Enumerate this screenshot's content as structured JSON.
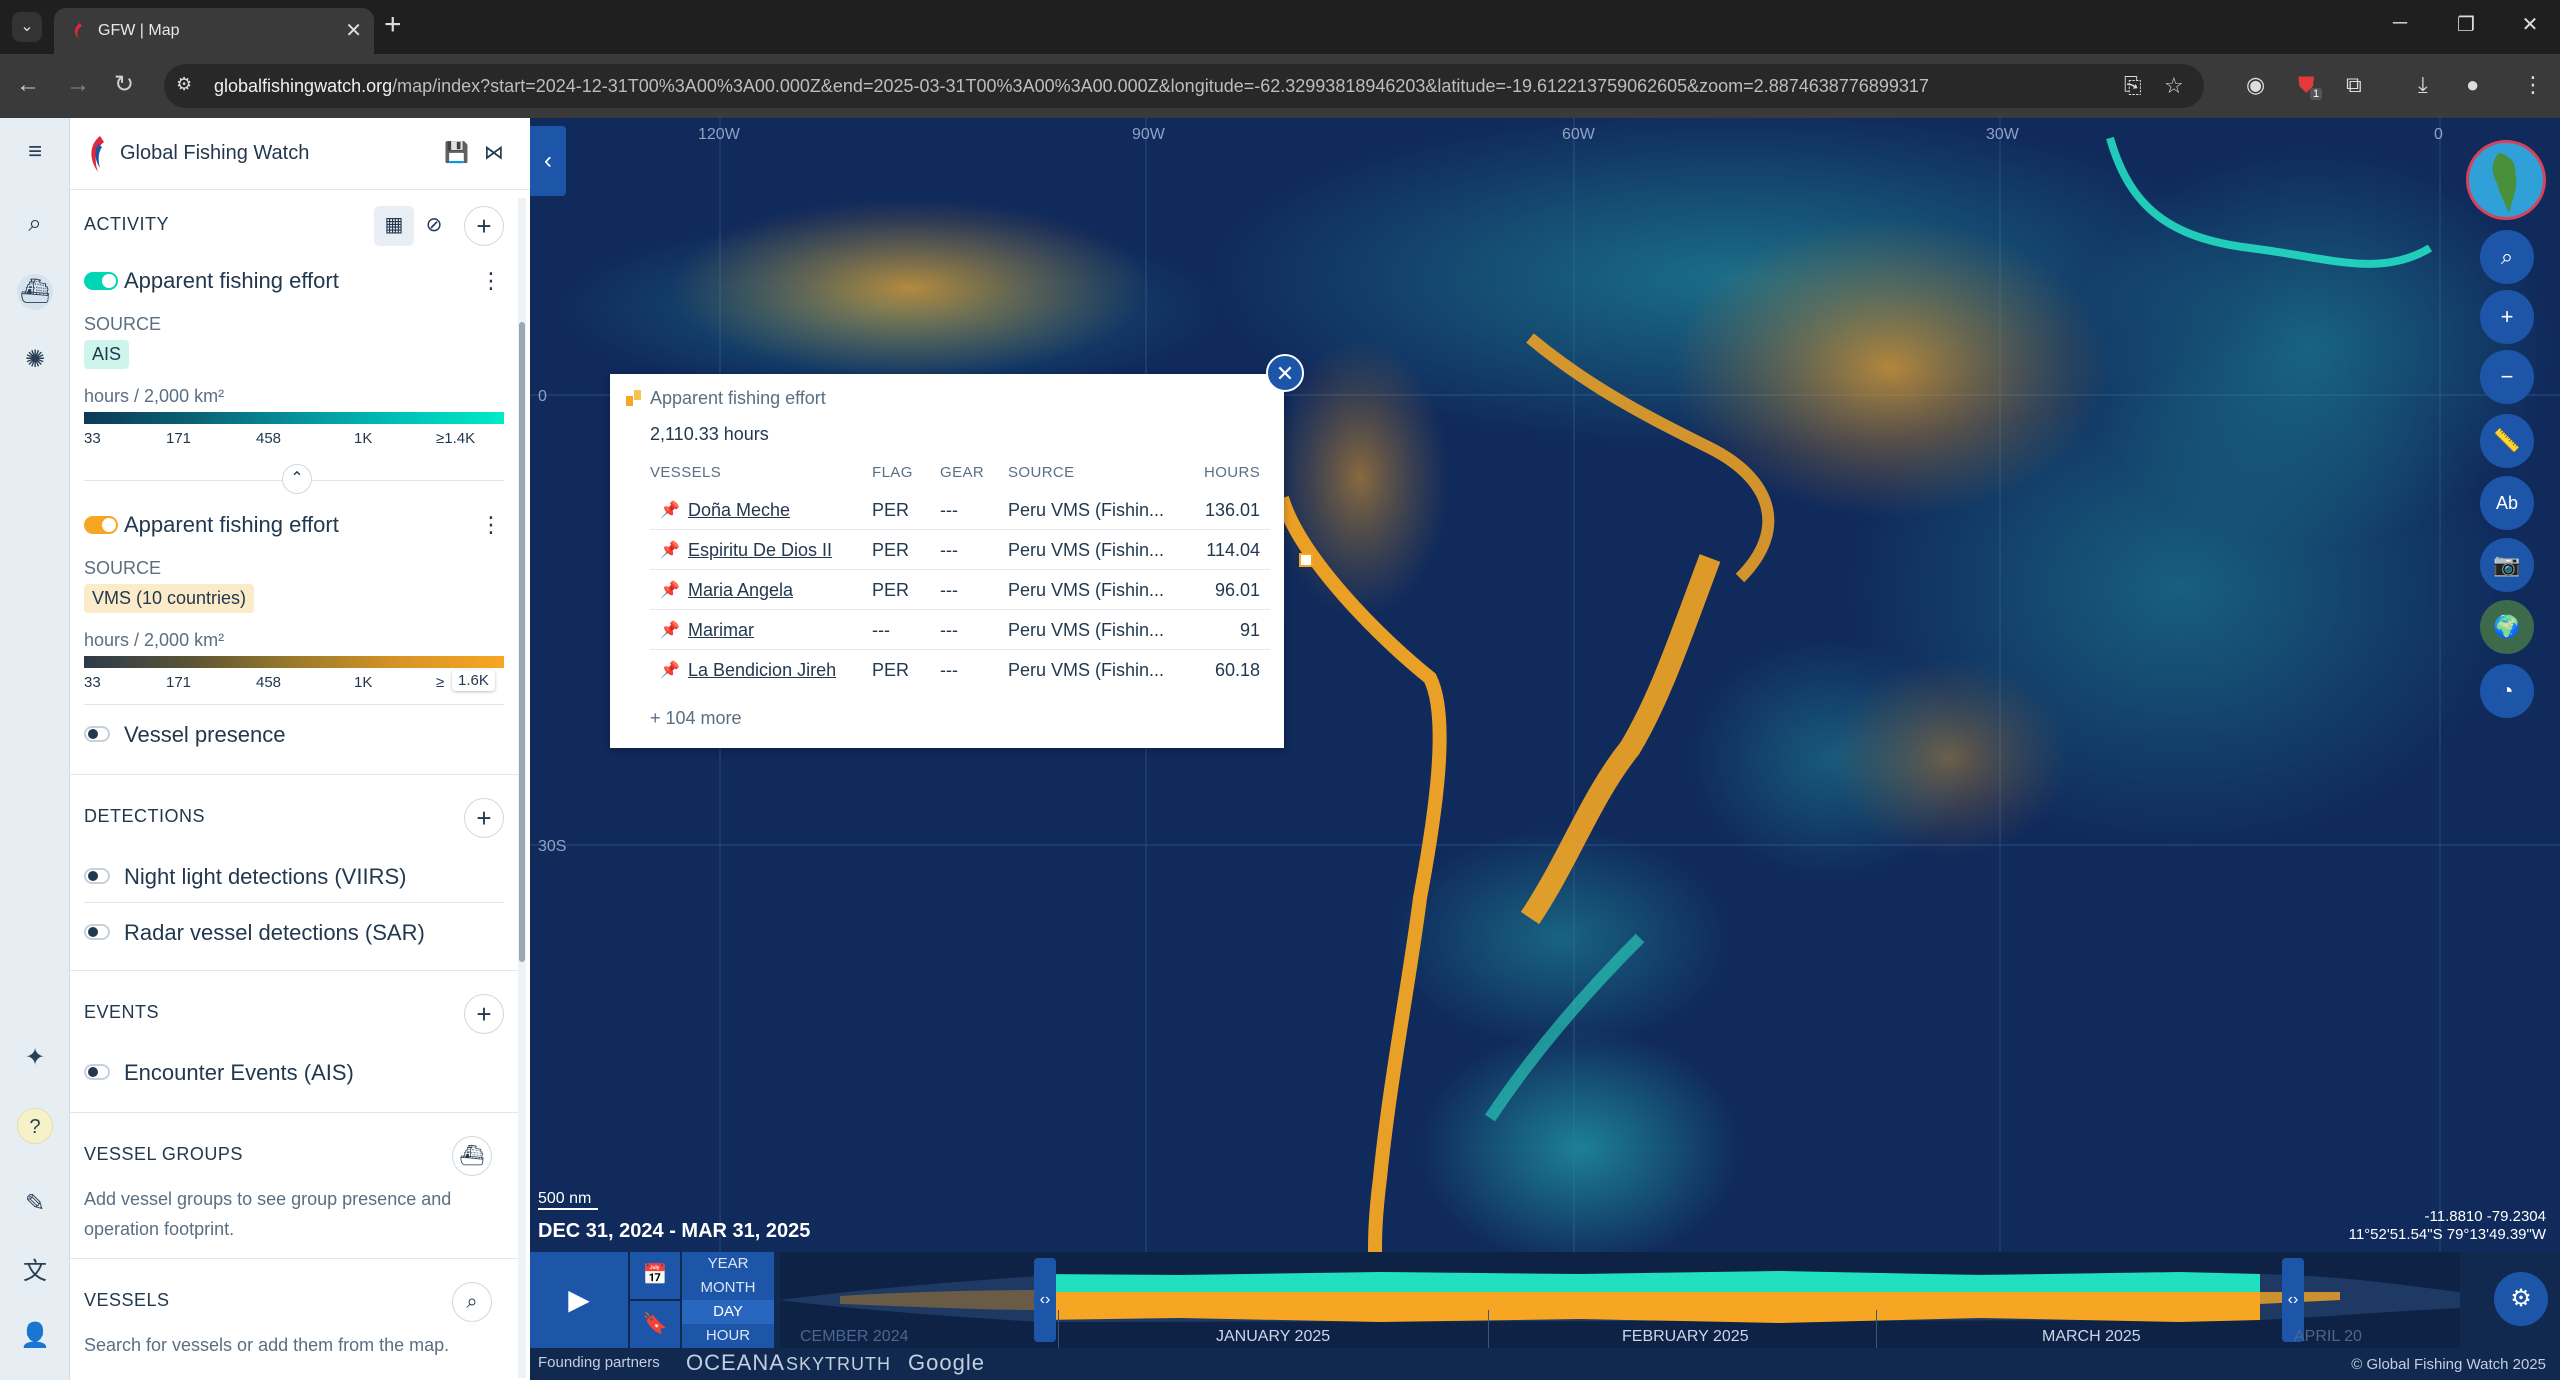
{
  "browser": {
    "tab_title": "GFW | Map",
    "url_host": "globalfishingwatch.org",
    "url_path": "/map/index?start=2024-12-31T00%3A00%3A00.000Z&end=2025-03-31T00%3A00%3A00.000Z&longitude=-62.32993818946203&latitude=-19.612213759062605&zoom=2.8874638776899317",
    "ext_badge": "1"
  },
  "sidebar": {
    "brand": "Global Fishing Watch",
    "activity": {
      "title": "ACTIVITY",
      "layers": [
        {
          "title": "Apparent fishing effort",
          "source_label": "SOURCE",
          "source": "AIS",
          "unit": "hours / 2,000 km²",
          "ticks": [
            "33",
            "171",
            "458",
            "1K",
            "≥1.4K"
          ],
          "color": "#00ebc5",
          "enabled": true
        },
        {
          "title": "Apparent fishing effort",
          "source_label": "SOURCE",
          "source": "VMS (10 countries)",
          "unit": "hours / 2,000 km²",
          "ticks": [
            "33",
            "171",
            "458",
            "1K",
            "≥"
          ],
          "hover_value": "1.6K",
          "color": "#f6a623",
          "enabled": true
        }
      ],
      "vessel_presence": "Vessel presence"
    },
    "detections": {
      "title": "DETECTIONS",
      "items": [
        "Night light detections (VIIRS)",
        "Radar vessel detections (SAR)"
      ]
    },
    "events": {
      "title": "EVENTS",
      "items": [
        "Encounter Events (AIS)"
      ]
    },
    "vessel_groups": {
      "title": "VESSEL GROUPS",
      "description": "Add vessel groups to see group presence and operation footprint."
    },
    "vessels": {
      "title": "VESSELS",
      "description": "Search for vessels or add them from the map."
    }
  },
  "map": {
    "lon_labels": [
      "120W",
      "90W",
      "60W",
      "30W",
      "0"
    ],
    "lat_labels": [
      "0",
      "30S"
    ],
    "scale": "500 nm",
    "date_range": "DEC 31, 2024 - MAR 31, 2025",
    "cursor_decimal": "-11.8810 -79.2304",
    "cursor_dms": "11°52'51.54\"S 79°13'49.39\"W"
  },
  "popup": {
    "title": "Apparent fishing effort",
    "total": "2,110.33 hours",
    "columns": [
      "VESSELS",
      "FLAG",
      "GEAR",
      "SOURCE",
      "HOURS"
    ],
    "rows": [
      {
        "name": "Doña Meche",
        "flag": "PER",
        "gear": "---",
        "source": "Peru VMS (Fishin...",
        "hours": "136.01"
      },
      {
        "name": "Espiritu De Dios II",
        "flag": "PER",
        "gear": "---",
        "source": "Peru VMS (Fishin...",
        "hours": "114.04"
      },
      {
        "name": "Maria Angela",
        "flag": "PER",
        "gear": "---",
        "source": "Peru VMS (Fishin...",
        "hours": "96.01"
      },
      {
        "name": "Marimar",
        "flag": "---",
        "gear": "---",
        "source": "Peru VMS (Fishin...",
        "hours": "91"
      },
      {
        "name": "La Bendicion Jireh",
        "flag": "PER",
        "gear": "---",
        "source": "Peru VMS (Fishin...",
        "hours": "60.18"
      }
    ],
    "more": "+ 104 more"
  },
  "timebar": {
    "intervals": [
      "YEAR",
      "MONTH",
      "DAY",
      "HOUR"
    ],
    "active_interval": "DAY",
    "months": [
      "CEMBER 2024",
      "JANUARY 2025",
      "FEBRUARY 2025",
      "MARCH 2025",
      "APRIL 20"
    ],
    "footer_partners_label": "Founding partners",
    "partners": [
      "OCEANA",
      "SKYTRUTH",
      "Google"
    ],
    "copyright": "© Global Fishing Watch 2025"
  },
  "colors": {
    "ais": "#00ebc5",
    "vms": "#f6a623",
    "brand_blue": "#1d56a8",
    "ocean": "#102a5c"
  }
}
